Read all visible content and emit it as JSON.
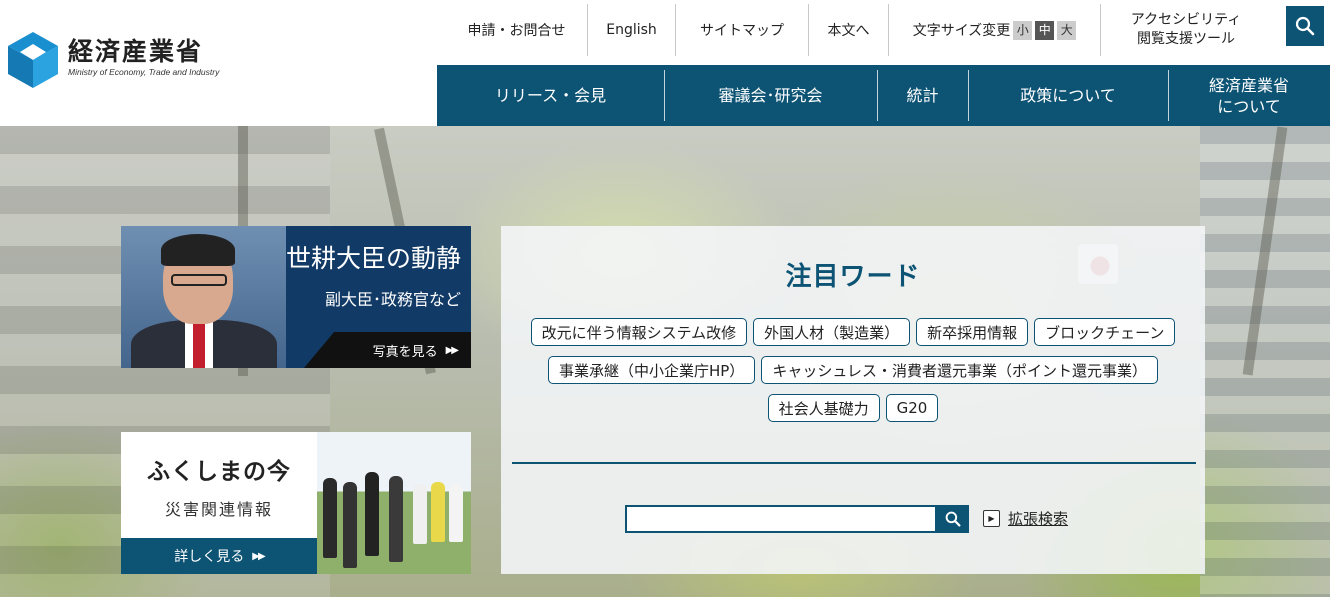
{
  "header": {
    "logo": {
      "name_jp": "経済産業省",
      "name_en": "Ministry of Economy, Trade and Industry",
      "brand_color": "#1a8fd0"
    },
    "util_links": {
      "contact": "申請・お問合せ",
      "english": "English",
      "sitemap": "サイトマップ",
      "skip_to_content": "本文へ",
      "font_size_label": "文字サイズ変更",
      "font_small": "小",
      "font_medium": "中",
      "font_large": "大",
      "accessibility_line1": "アクセシビリティ",
      "accessibility_line2": "閲覧支援ツール"
    },
    "search_icon": "search-icon",
    "nav": {
      "releases": "リリース・会見",
      "councils": "審議会･研究会",
      "statistics": "統計",
      "policy": "政策について",
      "about_line1": "経済産業省",
      "about_line2": "について"
    },
    "accent_color": "#0c5374"
  },
  "hero": {
    "minister_card": {
      "title": "世耕大臣の動静",
      "subtitle": "副大臣･政務官など",
      "link": "写真を見る",
      "link_icon": "double-chevron-right-icon"
    },
    "fukushima_card": {
      "title": "ふくしまの今",
      "subtitle": "災害関連情報",
      "link": "詳しく見る",
      "link_icon": "double-chevron-right-icon"
    },
    "featured": {
      "title": "注目ワード",
      "tags": [
        "改元に伴う情報システム改修",
        "外国人材（製造業）",
        "新卒採用情報",
        "ブロックチェーン",
        "事業承継（中小企業庁HP）",
        "キャッシュレス・消費者還元事業（ポイント還元事業）",
        "社会人基礎力",
        "G20"
      ],
      "search_value": "",
      "advanced_search": "拡張検索",
      "advanced_icon": "play-icon"
    }
  }
}
